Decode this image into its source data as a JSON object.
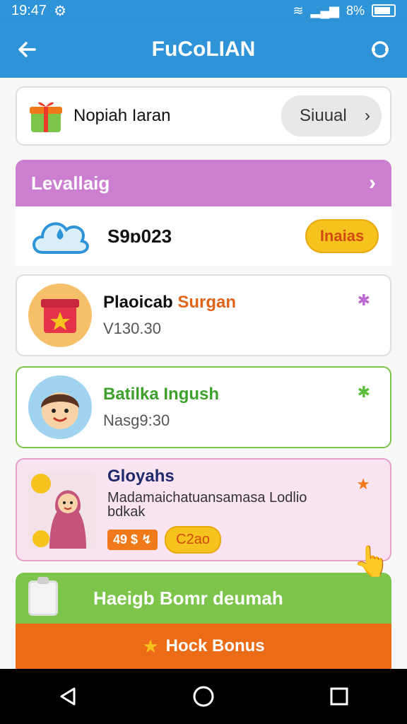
{
  "status": {
    "time": "19:47",
    "battery": "8%"
  },
  "app": {
    "title": "FuCoLIAN"
  },
  "promo": {
    "text": "Nopiah Iaran",
    "button": "Siuual"
  },
  "level": {
    "title": "Levallaig",
    "value": "S9ɒ023",
    "button": "Inaias"
  },
  "rewards": [
    {
      "name_a": "Plaoicab ",
      "name_b": "Surgan",
      "sub": "V130.30"
    },
    {
      "name": "Batilka Ingush",
      "sub": "Nasg9:30"
    },
    {
      "name": "Gloyahs",
      "desc": "Madamaichatuansamasa Lodlio bdkak",
      "tag": "49 $ ↯",
      "chip": "C2ao"
    }
  ],
  "actions": {
    "primary": "Haeigb Bomr deumah",
    "secondary": "Hock Bonus"
  },
  "colors": {
    "blue": "#2f93d8",
    "purple": "#cc7fd0",
    "green": "#7cc44a",
    "orange": "#ec6b16",
    "yellow": "#f6c21d"
  }
}
